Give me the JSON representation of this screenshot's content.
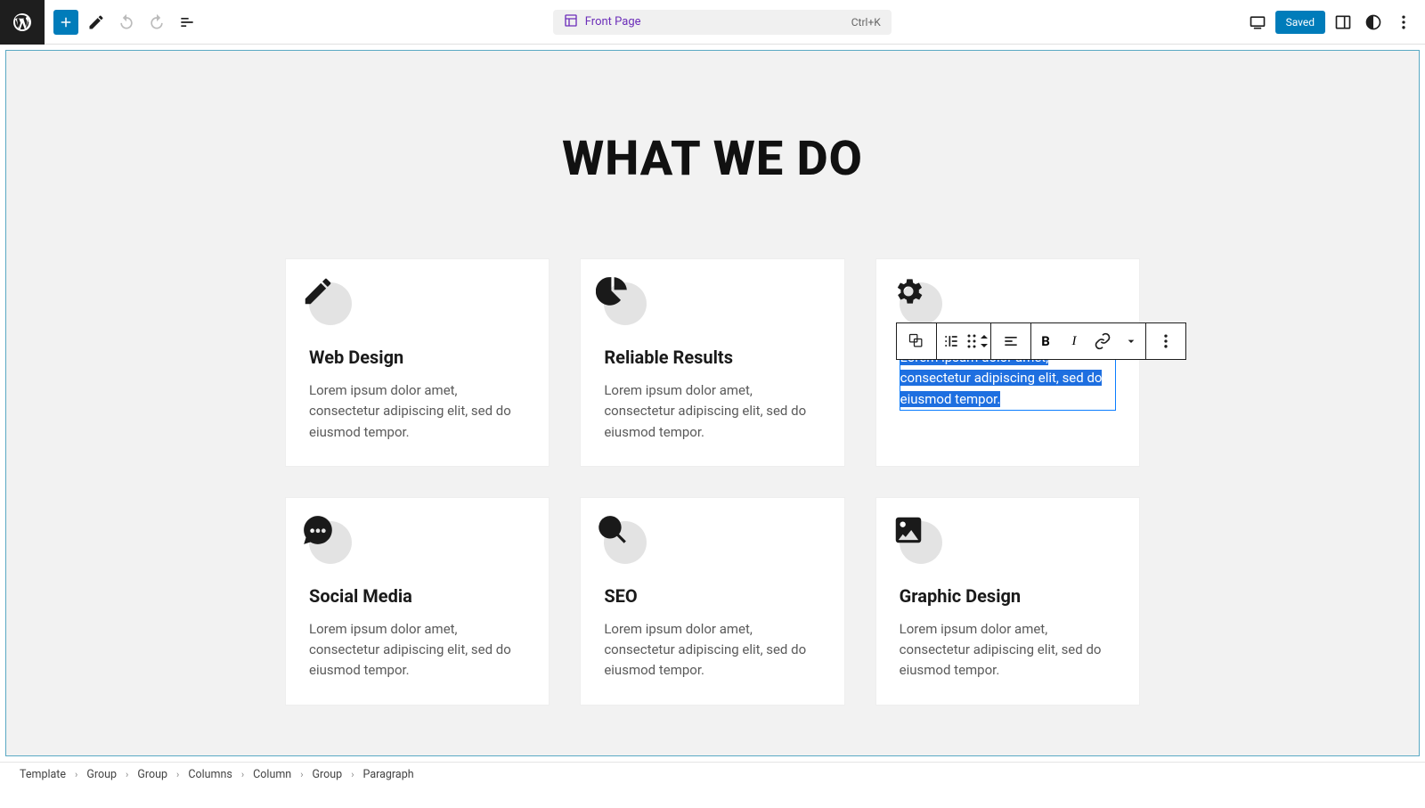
{
  "toolbar": {
    "page_label": "Front Page",
    "shortcut": "Ctrl+K",
    "saved_label": "Saved"
  },
  "section": {
    "title": "WHAT WE DO"
  },
  "cards": [
    {
      "title": "Web Design",
      "text": "Lorem ipsum dolor amet, consectetur adipiscing elit, sed do eiusmod tempor."
    },
    {
      "title": "Reliable Results",
      "text": "Lorem ipsum dolor amet, consectetur adipiscing elit, sed do eiusmod tempor."
    },
    {
      "title": "",
      "text": "Lorem ipsum dolor amet, consectetur adipiscing elit, sed do eiusmod tempor."
    },
    {
      "title": "Social Media",
      "text": "Lorem ipsum dolor amet, consectetur adipiscing elit, sed do eiusmod tempor."
    },
    {
      "title": "SEO",
      "text": "Lorem ipsum dolor amet, consectetur adipiscing elit, sed do eiusmod tempor."
    },
    {
      "title": "Graphic Design",
      "text": "Lorem ipsum dolor amet, consectetur adipiscing elit, sed do eiusmod tempor."
    }
  ],
  "breadcrumbs": [
    "Template",
    "Group",
    "Group",
    "Columns",
    "Column",
    "Group",
    "Paragraph"
  ]
}
